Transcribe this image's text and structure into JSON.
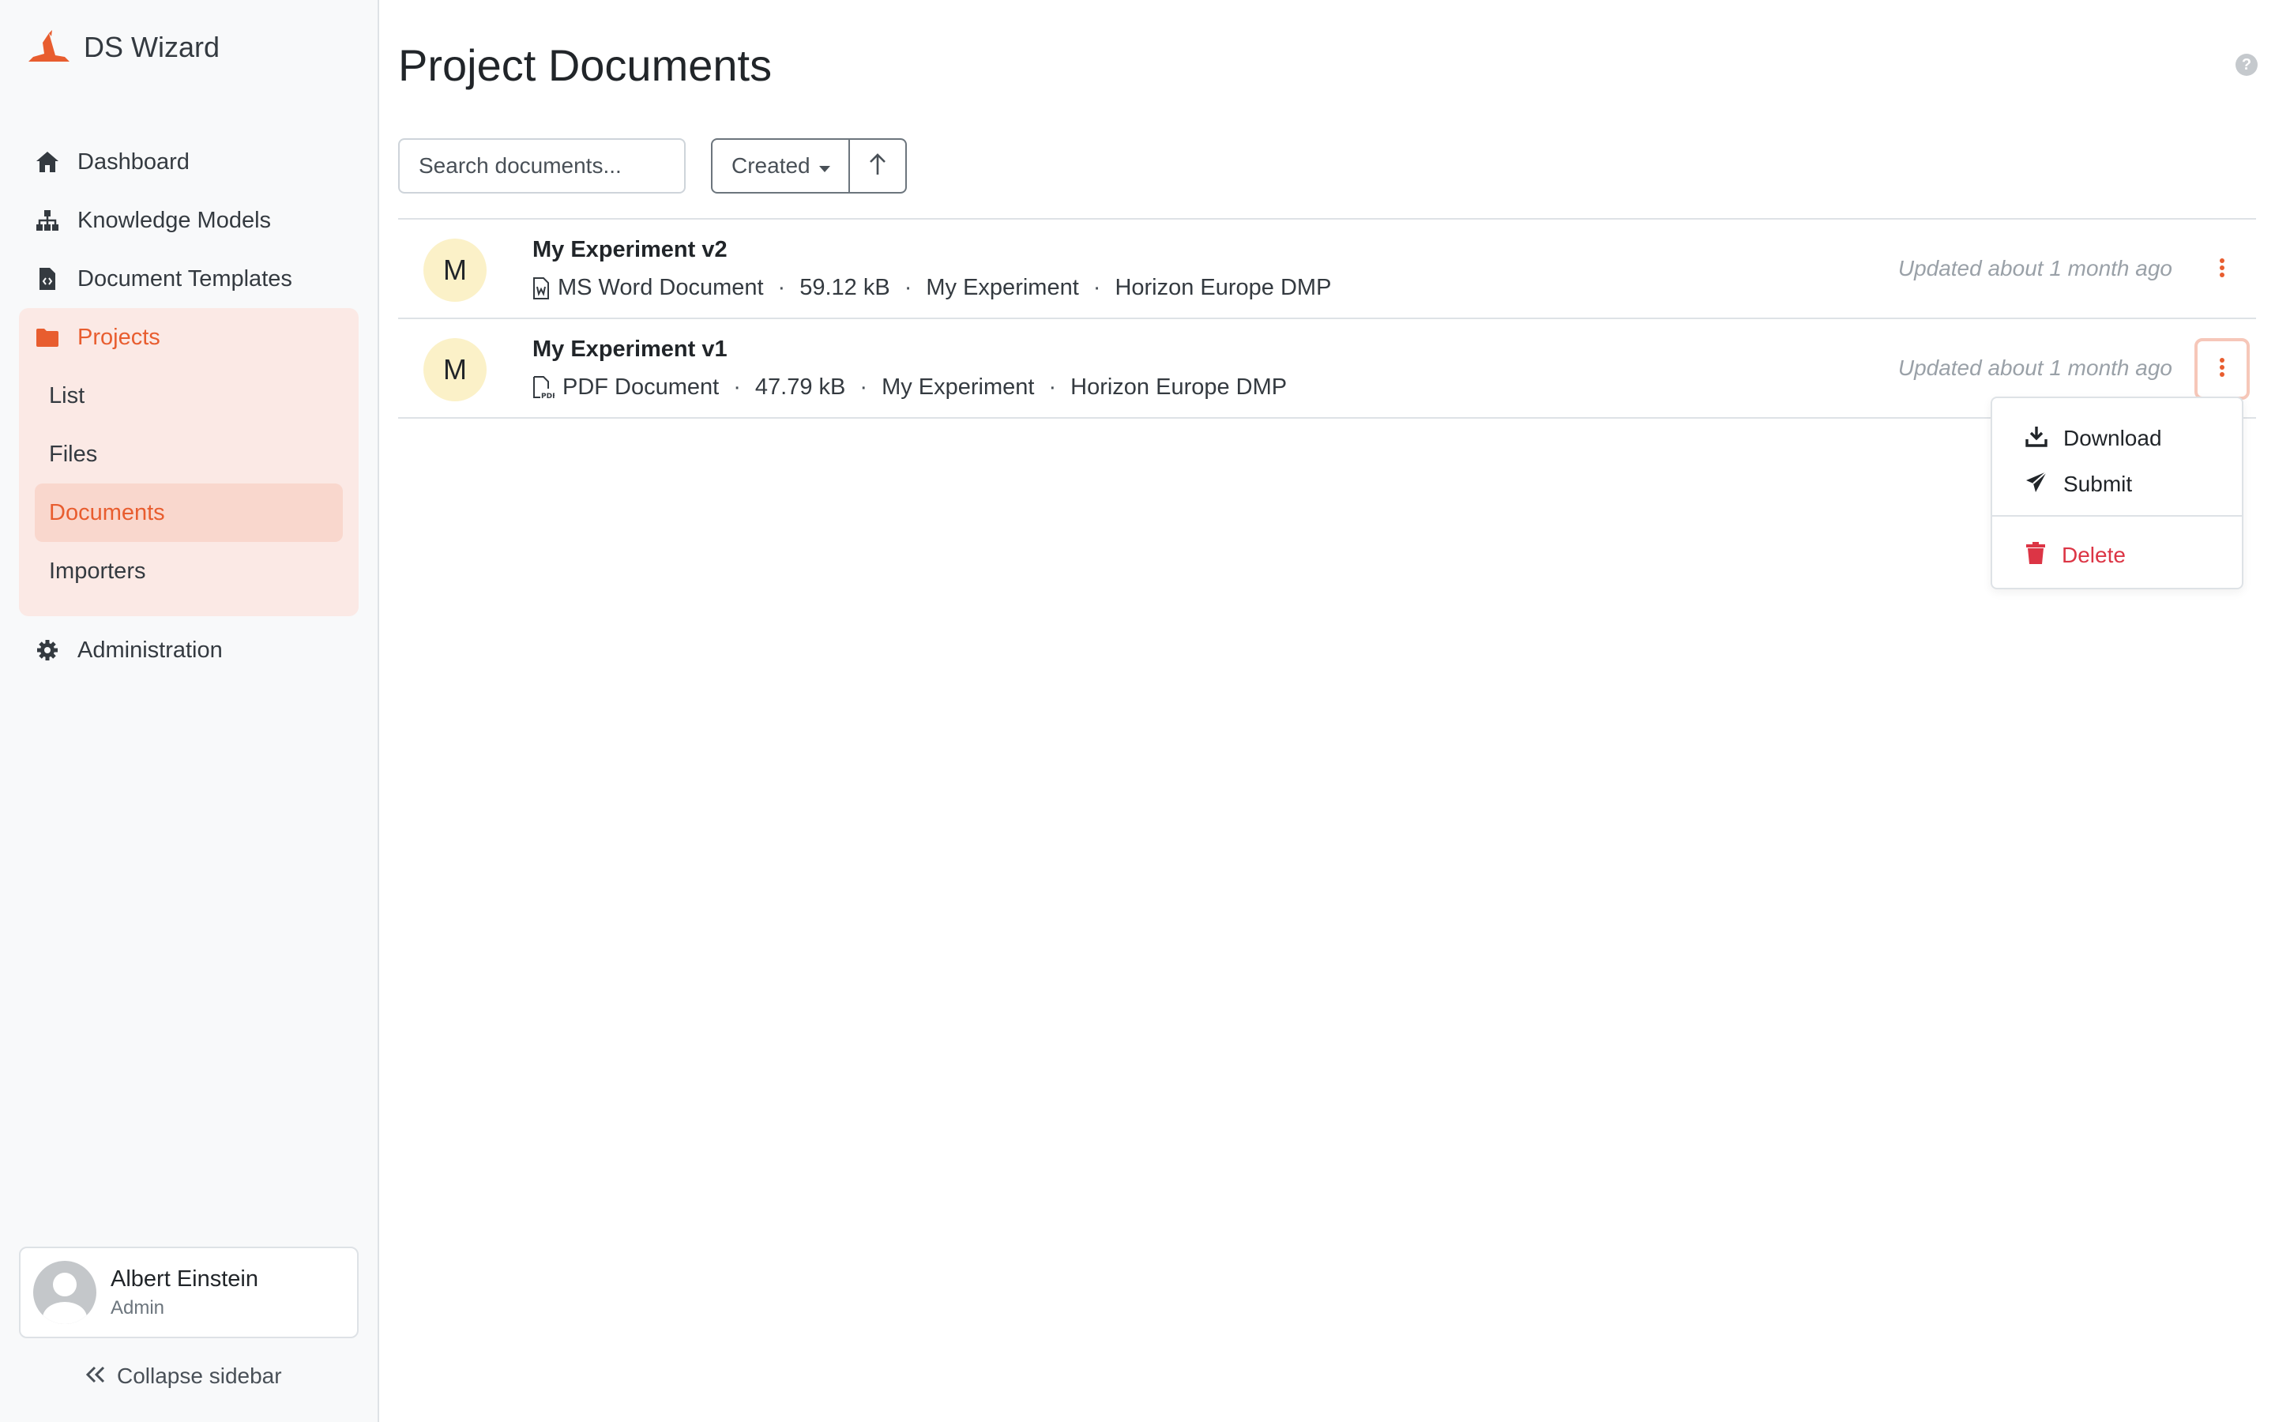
{
  "app": {
    "brand_name": "DS Wizard",
    "accent_color": "#e85d2f",
    "danger_color": "#dc3545"
  },
  "sidebar": {
    "items": [
      {
        "label": "Dashboard",
        "icon": "home-icon"
      },
      {
        "label": "Knowledge Models",
        "icon": "sitemap-icon"
      },
      {
        "label": "Document Templates",
        "icon": "file-code-icon"
      },
      {
        "label": "Projects",
        "icon": "folder-icon"
      },
      {
        "label": "Administration",
        "icon": "gear-icon"
      }
    ],
    "projects_sub": [
      {
        "label": "List"
      },
      {
        "label": "Files"
      },
      {
        "label": "Documents"
      },
      {
        "label": "Importers"
      }
    ],
    "user": {
      "name": "Albert Einstein",
      "role": "Admin"
    },
    "collapse_label": "Collapse sidebar"
  },
  "main": {
    "title": "Project Documents",
    "search_placeholder": "Search documents...",
    "sort_label": "Created",
    "documents": [
      {
        "initial": "M",
        "name": "My Experiment v2",
        "format": "MS Word Document",
        "format_icon": "file-word-icon",
        "size": "59.12 kB",
        "project": "My Experiment",
        "template": "Horizon Europe DMP",
        "updated": "Updated about 1 month ago"
      },
      {
        "initial": "M",
        "name": "My Experiment v1",
        "format": "PDF Document",
        "format_icon": "file-pdf-icon",
        "size": "47.79 kB",
        "project": "My Experiment",
        "template": "Horizon Europe DMP",
        "updated": "Updated about 1 month ago"
      }
    ],
    "dropdown": {
      "download": "Download",
      "submit": "Submit",
      "delete": "Delete"
    },
    "separator": "·"
  }
}
